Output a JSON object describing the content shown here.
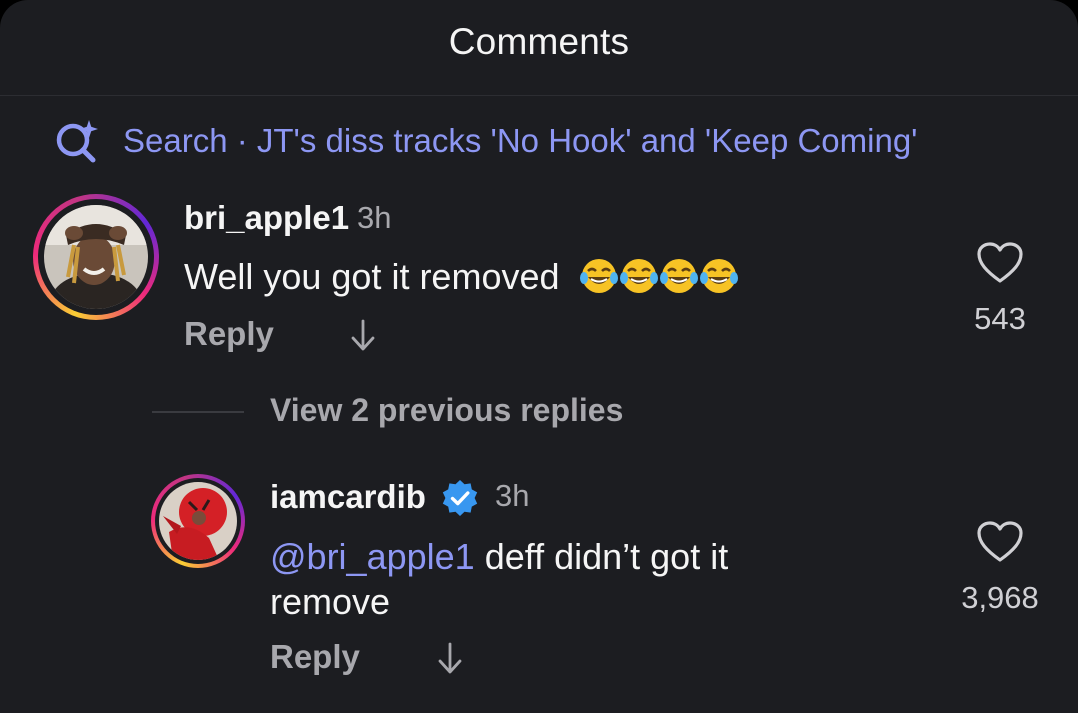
{
  "header": {
    "title": "Comments"
  },
  "search": {
    "label": "Search · JT's diss tracks 'No Hook' and 'Keep Coming'"
  },
  "comments": [
    {
      "username": "bri_apple1",
      "time": "3h",
      "text": "Well you got it removed",
      "emoji": [
        "face-with-tears-of-joy",
        "face-with-tears-of-joy",
        "face-with-tears-of-joy",
        "face-with-tears-of-joy"
      ],
      "reply_label": "Reply",
      "likes": "543"
    }
  ],
  "thread": {
    "view_replies_label": "View 2 previous replies"
  },
  "replies": [
    {
      "username": "iamcardib",
      "verified": true,
      "time": "3h",
      "mention": "@bri_apple1",
      "text_line1": " deff didn’t got it",
      "text_line2": "remove",
      "reply_label": "Reply",
      "likes": "3,968"
    }
  ],
  "colors": {
    "background": "#1c1d21",
    "accent_link": "#8d97f3",
    "verified_blue": "#3897f0",
    "text_primary": "#f5f5f5",
    "text_secondary": "#a8a8ad"
  }
}
